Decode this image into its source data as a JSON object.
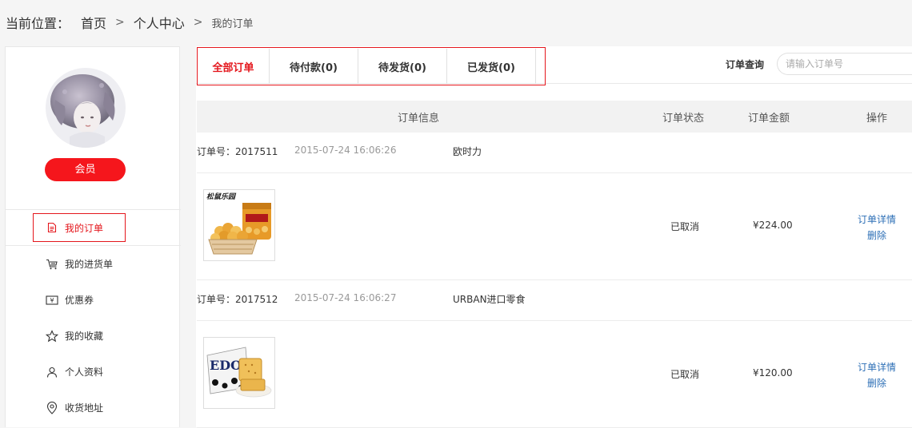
{
  "breadcrumb": {
    "label": "当前位置：",
    "items": [
      "首页",
      "个人中心",
      "我的订单"
    ],
    "sep": ">"
  },
  "sidebar": {
    "member_label": "会员",
    "menu": [
      {
        "label": "我的订单",
        "icon": "document-icon"
      },
      {
        "label": "我的进货单",
        "icon": "cart-icon"
      },
      {
        "label": "优惠券",
        "icon": "coupon-icon"
      },
      {
        "label": "我的收藏",
        "icon": "star-icon"
      },
      {
        "label": "个人资料",
        "icon": "user-icon"
      },
      {
        "label": "收货地址",
        "icon": "location-icon"
      }
    ]
  },
  "tabs": [
    "全部订单",
    "待付款(0)",
    "待发货(0)",
    "已发货(0)"
  ],
  "search": {
    "label": "订单查询",
    "placeholder": "请输入订单号"
  },
  "table_headers": {
    "info": "订单信息",
    "status": "订单状态",
    "amount": "订单金额",
    "action": "操作"
  },
  "orders": [
    {
      "order_no": "订单号：2017511",
      "time": "2015-07-24 16:06:26",
      "shop": "欧时力",
      "status": "已取消",
      "amount": "¥224.00",
      "detail_label": "订单详情",
      "delete_label": "删除",
      "product_image": "popcorn-product-image"
    },
    {
      "order_no": "订单号：2017512",
      "time": "2015-07-24 16:06:27",
      "shop": "URBAN进口零食",
      "status": "已取消",
      "amount": "¥120.00",
      "detail_label": "订单详情",
      "delete_label": "删除",
      "product_image": "edo-crackers-product-image"
    }
  ],
  "colors": {
    "accent": "#e4161c",
    "link": "#2d6fb6",
    "header_bg": "#f2f2f2"
  }
}
